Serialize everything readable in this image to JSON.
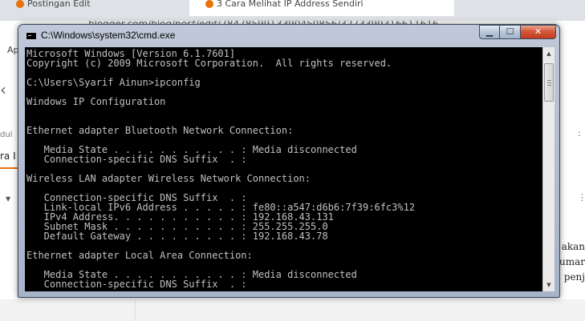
{
  "browser": {
    "tab1_title": "Postingan Edit",
    "tab2_title": "3 Cara Melihat IP Address Sendiri",
    "address_text": "blogger.com/blog/post/edit/7847859913390450856/3273399316611616",
    "bookmark_label": "Ap",
    "side_text_1": "dul",
    "side_text_2": "ra I",
    "right_text_1": "akan",
    "right_text_2": "umar",
    "right_text_3": "penj",
    "back_icon": "‹"
  },
  "window": {
    "title": "C:\\Windows\\system32\\cmd.exe",
    "min_label": "▁",
    "max_label": "☐",
    "close_label": "✕"
  },
  "console": {
    "lines": [
      "Microsoft Windows [Version 6.1.7601]",
      "Copyright (c) 2009 Microsoft Corporation.  All rights reserved.",
      "",
      "C:\\Users\\Syarif Ainun>ipconfig",
      "",
      "Windows IP Configuration",
      "",
      "",
      "Ethernet adapter Bluetooth Network Connection:",
      "",
      "   Media State . . . . . . . . . . . : Media disconnected",
      "   Connection-specific DNS Suffix  . :",
      "",
      "Wireless LAN adapter Wireless Network Connection:",
      "",
      "   Connection-specific DNS Suffix  . :",
      "   Link-local IPv6 Address . . . . . : fe80::a547:d6b6:7f39:6fc3%12",
      "   IPv4 Address. . . . . . . . . . . : 192.168.43.131",
      "   Subnet Mask . . . . . . . . . . . : 255.255.255.0",
      "   Default Gateway . . . . . . . . . : 192.168.43.78",
      "",
      "Ethernet adapter Local Area Connection:",
      "",
      "   Media State . . . . . . . . . . . : Media disconnected",
      "   Connection-specific DNS Suffix  . :"
    ]
  },
  "scrollbar": {
    "up_arrow": "▲",
    "down_arrow": "▼"
  }
}
